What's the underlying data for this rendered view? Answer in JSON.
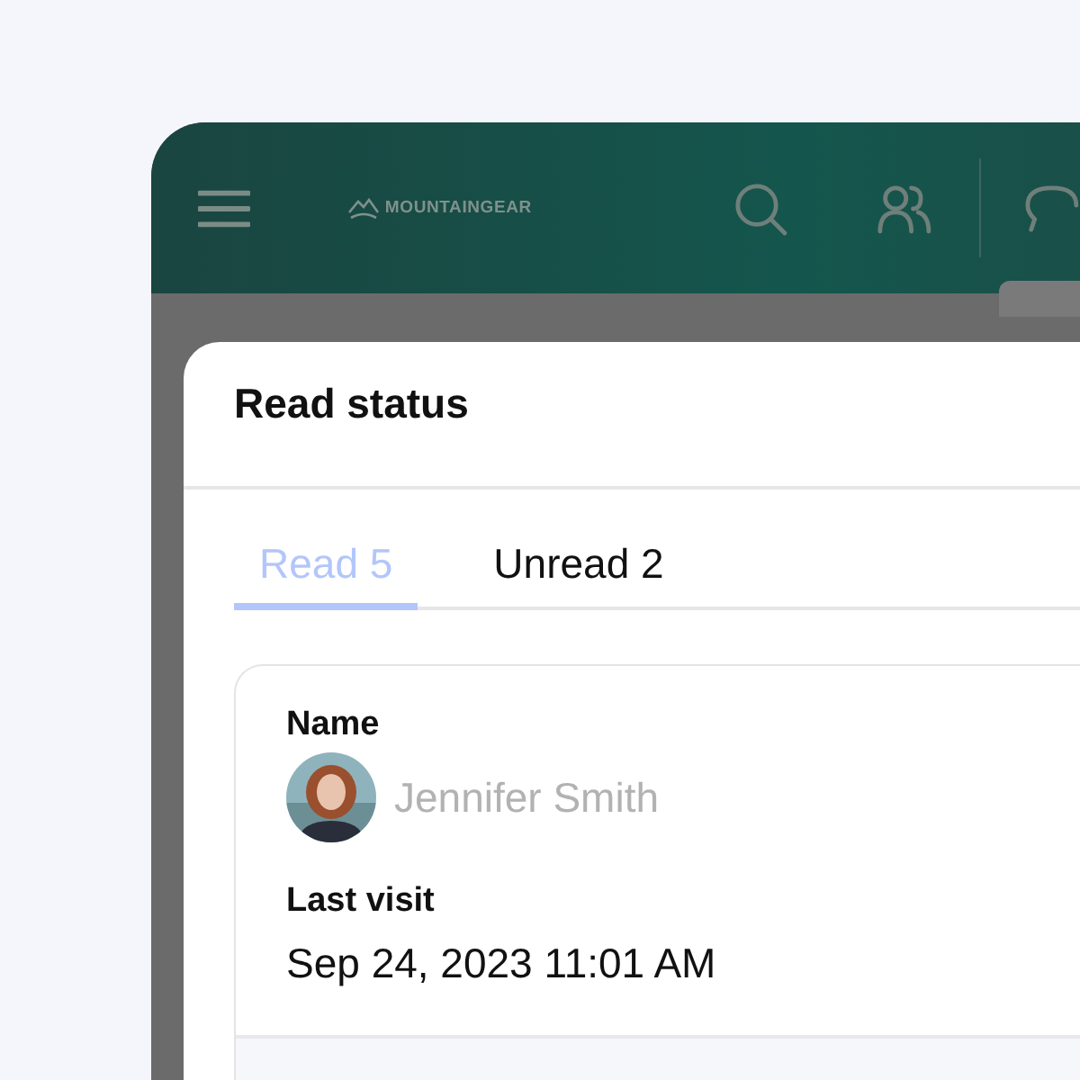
{
  "header": {
    "logo": "MOUNTAINGEAR"
  },
  "dialog": {
    "title": "Read status",
    "tabs": [
      {
        "label": "Read 5",
        "selected": true
      },
      {
        "label": "Unread 2",
        "selected": false
      }
    ],
    "records": [
      {
        "name_label": "Name",
        "name": "Jennifer Smith",
        "visit_label": "Last visit",
        "last_visit": "Sep 24, 2023 11:01 AM"
      }
    ]
  }
}
